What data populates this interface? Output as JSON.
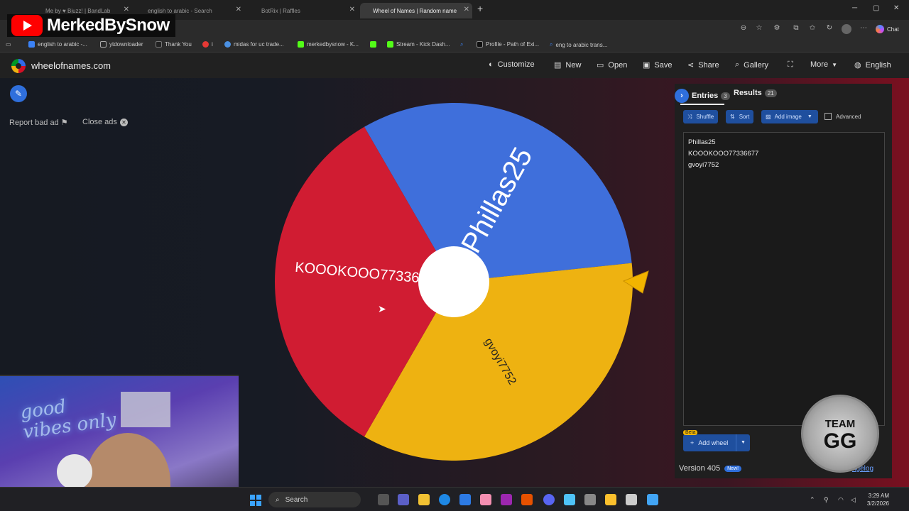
{
  "browser": {
    "tabs": [
      {
        "label": "Me by ♥ Bịuzz! | BandLab",
        "active": false
      },
      {
        "label": "english to arabic - Search",
        "active": false
      },
      {
        "label": "BotRix | Raffles",
        "active": false
      },
      {
        "label": "Wheel of Names | Random name",
        "active": true
      }
    ],
    "bookmarks": [
      {
        "label": "english to arabic -...",
        "color": "#3b82f6"
      },
      {
        "label": "ytdownloader",
        "color": "#999999"
      },
      {
        "label": "Thank You",
        "color": "#222222"
      },
      {
        "label": "i",
        "color": "#e53935"
      },
      {
        "label": "midas for uc trade...",
        "color": "#4a90e2"
      },
      {
        "label": "merkedbysnow - K...",
        "color": "#53fc18"
      },
      {
        "label": "",
        "color": "#53fc18"
      },
      {
        "label": "Stream - Kick Dash...",
        "color": "#53fc18"
      },
      {
        "label": "",
        "color": "#3b82f6"
      },
      {
        "label": "Profile - Path of Exi...",
        "color": "#111111"
      },
      {
        "label": "eng to arabic trans...",
        "color": "#3b82f6"
      }
    ],
    "chat_label": "Chat"
  },
  "channel": {
    "name": "MerkedBySnow"
  },
  "site": {
    "name": "wheelofnames.com",
    "menu": {
      "customize": "Customize",
      "new": "New",
      "open": "Open",
      "save": "Save",
      "share": "Share",
      "gallery": "Gallery",
      "more": "More",
      "language": "English"
    }
  },
  "left": {
    "report_bad_ad": "Report bad ad",
    "close_ads": "Close ads"
  },
  "wheel": {
    "segments": [
      {
        "label": "Phillas25",
        "color": "#3f6fdb"
      },
      {
        "label": "gvoyi7752",
        "color": "#eeb211"
      },
      {
        "label": "KOOOKOOO77336677",
        "color": "#d01c32"
      }
    ]
  },
  "panel": {
    "entries_tab": "Entries",
    "entries_count": "3",
    "results_tab": "Results",
    "results_count": "21",
    "shuffle": "Shuffle",
    "sort": "Sort",
    "add_image": "Add image",
    "advanced": "Advanced",
    "entries": [
      "Phillas25",
      "KOOOKOOO77336677",
      "gvoyi7752"
    ],
    "beta": "Beta",
    "add_wheel": "Add wheel",
    "version": "Version 405",
    "new_badge": "New!",
    "changelog": "ngelog"
  },
  "badge": {
    "line1": "TEAM",
    "line2": "GG"
  },
  "webcam": {
    "neon_text": "good vibes only"
  },
  "taskbar": {
    "search": "Search",
    "time": "3:29 AM",
    "date": "3/2/2026"
  }
}
